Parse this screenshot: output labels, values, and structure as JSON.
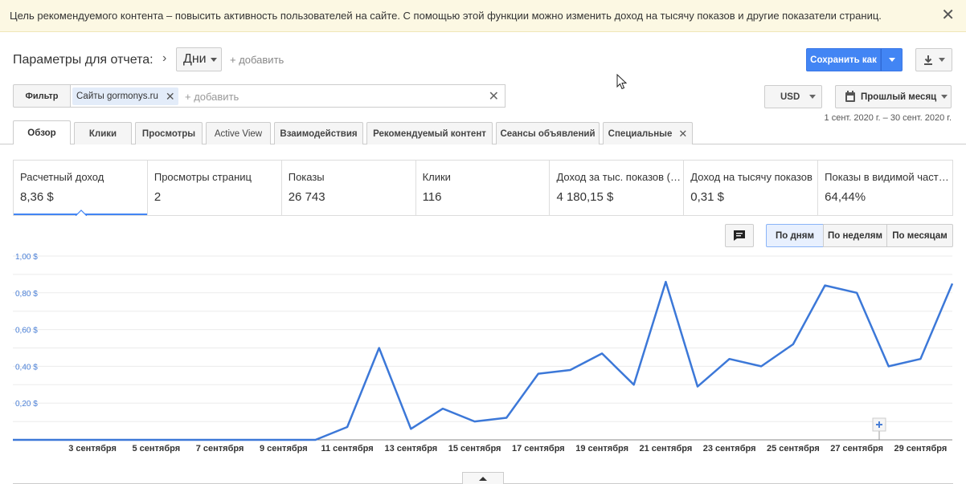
{
  "banner": {
    "text": "Цель рекомендуемого контента – повысить активность пользователей на сайте. С помощью этой функции можно изменить доход на тысячу показов и другие показатели страниц.",
    "close": "✕"
  },
  "header": {
    "report_params_label": "Параметры для отчета:",
    "dimension": "Дни",
    "add_label": "+ добавить",
    "save_label": "Сохранить как"
  },
  "filter": {
    "button_label": "Фильтр",
    "chip_label": "Сайты gormonys.ru",
    "add_placeholder": "+ добавить"
  },
  "currency": "USD",
  "period": "Прошлый месяц",
  "date_range": "1 сент. 2020 г. – 30 сент. 2020 г.",
  "tabs": [
    {
      "label": "Обзор"
    },
    {
      "label": "Клики"
    },
    {
      "label": "Просмотры"
    },
    {
      "label": "Active View"
    },
    {
      "label": "Взаимодействия"
    },
    {
      "label": "Рекомендуемый контент"
    },
    {
      "label": "Сеансы объявлений"
    },
    {
      "label": "Специальные"
    }
  ],
  "metrics": [
    {
      "label": "Расчетный доход",
      "value": "8,36 $"
    },
    {
      "label": "Просмотры страниц",
      "value": "2"
    },
    {
      "label": "Показы",
      "value": "26 743"
    },
    {
      "label": "Клики",
      "value": "116"
    },
    {
      "label": "Доход за тыс. показов (RPM)",
      "value": "4 180,15 $"
    },
    {
      "label": "Доход на тысячу показов",
      "value": "0,31 $"
    },
    {
      "label": "Показы в видимой части экрана",
      "value": "64,44%"
    }
  ],
  "granularity": {
    "days": "По дням",
    "weeks": "По неделям",
    "months": "По месяцам"
  },
  "colors": {
    "accent": "#4285f4",
    "line": "#3c78d8",
    "banner_bg": "#fcf8e3"
  },
  "chart_data": {
    "type": "line",
    "ylim": [
      0,
      1.0
    ],
    "y_ticks": [
      {
        "value": 0.2,
        "label": "0,20 $"
      },
      {
        "value": 0.4,
        "label": "0,40 $"
      },
      {
        "value": 0.6,
        "label": "0,60 $"
      },
      {
        "value": 0.8,
        "label": "0,80 $"
      },
      {
        "value": 1.0,
        "label": "1,00 $"
      }
    ],
    "x_labels": [
      {
        "day": 3,
        "label": "3 сентября"
      },
      {
        "day": 5,
        "label": "5 сентября"
      },
      {
        "day": 7,
        "label": "7 сентября"
      },
      {
        "day": 9,
        "label": "9 сентября"
      },
      {
        "day": 11,
        "label": "11 сентября"
      },
      {
        "day": 13,
        "label": "13 сентября"
      },
      {
        "day": 15,
        "label": "15 сентября"
      },
      {
        "day": 17,
        "label": "17 сентября"
      },
      {
        "day": 19,
        "label": "19 сентября"
      },
      {
        "day": 21,
        "label": "21 сентября"
      },
      {
        "day": 23,
        "label": "23 сентября"
      },
      {
        "day": 25,
        "label": "25 сентября"
      },
      {
        "day": 27,
        "label": "27 сентября"
      },
      {
        "day": 29,
        "label": "29 сентября"
      }
    ],
    "series": [
      {
        "x": [
          1,
          2,
          3,
          4,
          5,
          6,
          7,
          8,
          9,
          10,
          11,
          12,
          13,
          14,
          15,
          16,
          17,
          18,
          19,
          20,
          21,
          22,
          23,
          24,
          25,
          26,
          27,
          28,
          29,
          30
        ],
        "values": [
          0,
          0,
          0,
          0,
          0,
          0,
          0,
          0,
          0,
          0,
          0.07,
          0.5,
          0.06,
          0.17,
          0.1,
          0.12,
          0.36,
          0.38,
          0.47,
          0.3,
          0.86,
          0.29,
          0.44,
          0.4,
          0.52,
          0.84,
          0.8,
          0.4,
          0.44,
          0.85
        ]
      }
    ],
    "grid": true
  }
}
